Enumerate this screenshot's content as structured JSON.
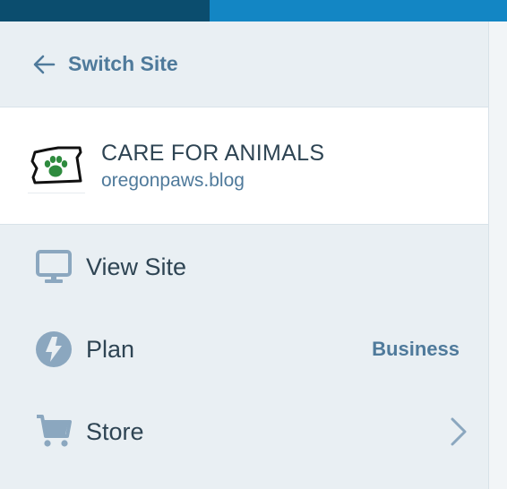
{
  "colors": {
    "masterbar_left": "#0b4d6e",
    "masterbar_right": "#1386c4",
    "sidebar_bg": "#e9eff3",
    "text_primary": "#2e4453",
    "text_link": "#4f7a9b",
    "icon": "#8ba7bf",
    "paw_green": "#2e8b3e"
  },
  "switch_site": {
    "label": "Switch Site",
    "icon": "arrow-left-icon"
  },
  "site": {
    "title": "CARE FOR ANIMALS",
    "domain": "oregonpaws.blog",
    "icon": "oregon-paw-logo"
  },
  "menu": [
    {
      "label": "View Site",
      "icon": "monitor-icon"
    },
    {
      "label": "Plan",
      "icon": "lightning-bolt-icon",
      "badge": "Business"
    },
    {
      "label": "Store",
      "icon": "cart-icon",
      "trailing": "chevron-right-icon"
    }
  ]
}
